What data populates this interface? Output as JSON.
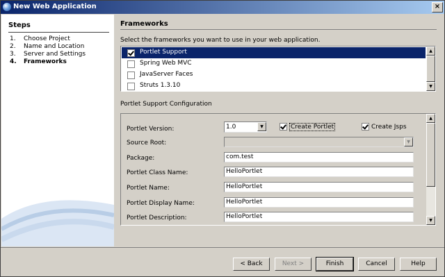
{
  "window": {
    "title": "New Web Application",
    "close_label": "×"
  },
  "steps": {
    "heading": "Steps",
    "items": [
      {
        "num": "1.",
        "label": "Choose Project"
      },
      {
        "num": "2.",
        "label": "Name and Location"
      },
      {
        "num": "3.",
        "label": "Server and Settings"
      },
      {
        "num": "4.",
        "label": "Frameworks"
      }
    ]
  },
  "frameworks": {
    "heading": "Frameworks",
    "instruction": "Select the frameworks you want to use in your web application.",
    "items": [
      {
        "label": "Portlet Support",
        "checked": true,
        "selected": true
      },
      {
        "label": "Spring Web MVC",
        "checked": false
      },
      {
        "label": "JavaServer Faces",
        "checked": false
      },
      {
        "label": "Struts 1.3.10",
        "checked": false
      }
    ]
  },
  "config": {
    "heading": "Portlet Support Configuration",
    "portlet_version_label": "Portlet Version:",
    "portlet_version_value": "1.0",
    "create_portlet_label": "Create Portlet",
    "create_jsps_label": "Create Jsps",
    "source_root_label": "Source Root:",
    "source_root_value": "",
    "package_label": "Package:",
    "package_value": "com.test",
    "class_name_label": "Portlet Class Name:",
    "class_name_value": "HelloPortlet",
    "name_label": "Portlet Name:",
    "name_value": "HelloPortlet",
    "display_name_label": "Portlet Display Name:",
    "display_name_value": "HelloPortlet",
    "description_label": "Portlet Description:",
    "description_value": "HelloPortlet"
  },
  "buttons": {
    "back": "< Back",
    "next": "Next >",
    "finish": "Finish",
    "cancel": "Cancel",
    "help": "Help"
  },
  "colors": {
    "selection": "#0a246a",
    "title_start": "#0a246a",
    "title_end": "#a6caf0",
    "dialog_bg": "#d4d0c8"
  }
}
